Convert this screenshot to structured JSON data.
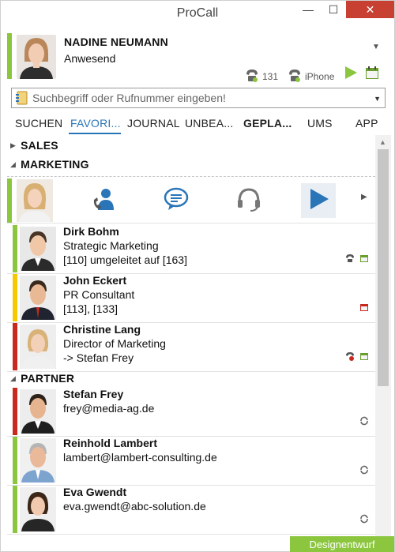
{
  "window": {
    "title": "ProCall",
    "minimize": "—",
    "maximize": "☐",
    "close": "✕"
  },
  "profile": {
    "name": "NADINE NEUMANN",
    "status": "Anwesend",
    "status_color": "#8cc63f",
    "devices": [
      {
        "icon": "desk-phone-icon",
        "label": "131"
      },
      {
        "icon": "mobile-phone-icon",
        "label": "iPhone"
      }
    ]
  },
  "search": {
    "placeholder": "Suchbegriff oder Rufnummer eingeben!",
    "value": ""
  },
  "tabs": [
    {
      "label": "SUCHEN"
    },
    {
      "label": "FAVORI..."
    },
    {
      "label": "JOURNAL"
    },
    {
      "label": "UNBEA..."
    },
    {
      "label": "GEPLA..."
    },
    {
      "label": "UMS"
    },
    {
      "label": "APP"
    }
  ],
  "groups": {
    "sales": "SALES",
    "marketing": "MARKETING",
    "partner": "PARTNER"
  },
  "action_bar": {
    "icons": [
      "contact-call-icon",
      "chat-icon",
      "headset-icon",
      "play-icon"
    ]
  },
  "marketing_contacts": [
    {
      "name": "Dirk Bohm",
      "line1": "Strategic Marketing",
      "line2": "[110] umgeleitet auf [163]",
      "status_color": "#8cc63f"
    },
    {
      "name": "John Eckert",
      "line1": "PR Consultant",
      "line2": "[113], [133]",
      "status_color": "#f5c800"
    },
    {
      "name": "Christine Lang",
      "line1": "Director of Marketing",
      "line2": "-> Stefan Frey",
      "status_color": "#c8281e"
    }
  ],
  "partner_contacts": [
    {
      "name": "Stefan Frey",
      "line1": "frey@media-ag.de",
      "status_color": "#c8281e"
    },
    {
      "name": "Reinhold Lambert",
      "line1": "lambert@lambert-consulting.de",
      "status_color": "#8cc63f"
    },
    {
      "name": "Eva Gwendt",
      "line1": "eva.gwendt@abc-solution.de",
      "status_color": "#8cc63f"
    }
  ],
  "footer_badge": "Designentwurf",
  "colors": {
    "accent": "#2a75b8",
    "available": "#8cc63f",
    "busy": "#c8281e",
    "away": "#f5c800",
    "close": "#c84031"
  }
}
